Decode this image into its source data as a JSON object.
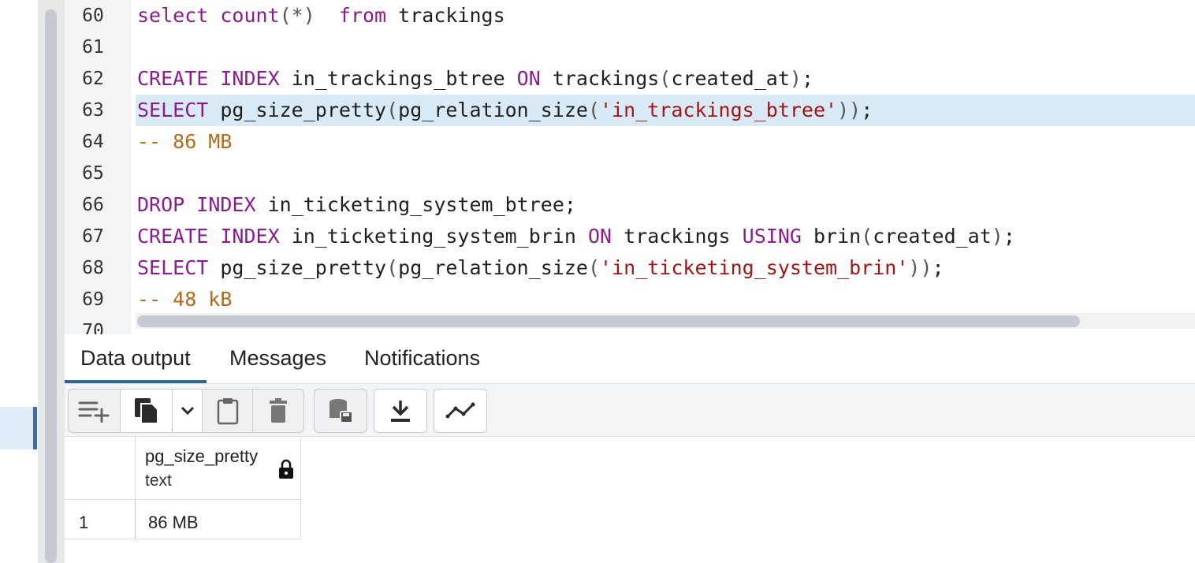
{
  "editor": {
    "lines": [
      {
        "num": "60",
        "segments": [
          [
            "kw",
            "select "
          ],
          [
            "kw",
            "count"
          ],
          [
            "punc",
            "(*)"
          ],
          [
            "",
            "  "
          ],
          [
            "kw",
            "from"
          ],
          [
            "",
            " trackings"
          ]
        ]
      },
      {
        "num": "61",
        "segments": []
      },
      {
        "num": "62",
        "segments": [
          [
            "kw",
            "CREATE"
          ],
          [
            "",
            " "
          ],
          [
            "kw",
            "INDEX"
          ],
          [
            "",
            " in_trackings_btree "
          ],
          [
            "kw",
            "ON"
          ],
          [
            "",
            " trackings"
          ],
          [
            "punc",
            "("
          ],
          [
            "",
            "created_at"
          ],
          [
            "punc",
            ")"
          ],
          [
            "",
            ";"
          ]
        ]
      },
      {
        "num": "63",
        "segments": [
          [
            "kw",
            "SELECT"
          ],
          [
            "",
            " pg_size_pretty"
          ],
          [
            "punc",
            "("
          ],
          [
            "",
            "pg_relation_size"
          ],
          [
            "punc",
            "("
          ],
          [
            "str",
            "'in_trackings_btree'"
          ],
          [
            "punc",
            "))"
          ],
          [
            "",
            ";"
          ]
        ],
        "active": true
      },
      {
        "num": "64",
        "segments": [
          [
            "cmt",
            "-- 86 MB"
          ]
        ]
      },
      {
        "num": "65",
        "segments": []
      },
      {
        "num": "66",
        "segments": [
          [
            "kw",
            "DROP"
          ],
          [
            "",
            " "
          ],
          [
            "kw",
            "INDEX"
          ],
          [
            "",
            " in_ticketing_system_btree;"
          ]
        ]
      },
      {
        "num": "67",
        "segments": [
          [
            "kw",
            "CREATE"
          ],
          [
            "",
            " "
          ],
          [
            "kw",
            "INDEX"
          ],
          [
            "",
            " in_ticketing_system_brin "
          ],
          [
            "kw",
            "ON"
          ],
          [
            "",
            " trackings "
          ],
          [
            "kw",
            "USING"
          ],
          [
            "",
            " brin"
          ],
          [
            "punc",
            "("
          ],
          [
            "",
            "created_at"
          ],
          [
            "punc",
            ")"
          ],
          [
            "",
            ";"
          ]
        ]
      },
      {
        "num": "68",
        "segments": [
          [
            "kw",
            "SELECT"
          ],
          [
            "",
            " pg_size_pretty"
          ],
          [
            "punc",
            "("
          ],
          [
            "",
            "pg_relation_size"
          ],
          [
            "punc",
            "("
          ],
          [
            "str",
            "'in_ticketing_system_brin'"
          ],
          [
            "punc",
            "))"
          ],
          [
            "",
            ";"
          ]
        ]
      },
      {
        "num": "69",
        "segments": [
          [
            "cmt",
            "-- 48 kB"
          ]
        ]
      },
      {
        "num": "70",
        "segments": []
      }
    ]
  },
  "results": {
    "tabs": [
      {
        "label": "Data output",
        "active": true
      },
      {
        "label": "Messages",
        "active": false
      },
      {
        "label": "Notifications",
        "active": false
      }
    ],
    "toolbar_icons": [
      "add-row-icon",
      "copy-icon",
      "chevron-down-icon",
      "paste-icon",
      "delete-icon",
      "save-data-icon",
      "download-icon",
      "graph-icon"
    ],
    "grid": {
      "column": {
        "name": "pg_size_pretty",
        "type": "text"
      },
      "rows": [
        {
          "num": "1",
          "value": "86 MB"
        }
      ]
    }
  }
}
